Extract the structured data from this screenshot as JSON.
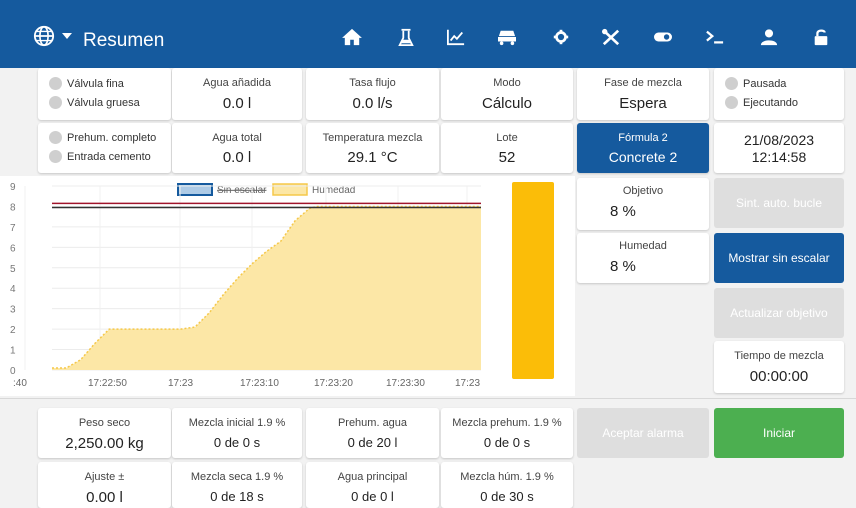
{
  "header": {
    "title": "Resumen",
    "icons": [
      "globe-icon",
      "home-icon",
      "flask-icon",
      "chart-icon",
      "mixer-truck-icon",
      "gear-icon",
      "tools-icon",
      "toggle-icon",
      "terminal-icon",
      "user-icon",
      "unlock-icon"
    ]
  },
  "indicators": {
    "valvula_fina": "Válvula fina",
    "valvula_gruesa": "Válvula gruesa",
    "prehum_completo": "Prehum. completo",
    "entrada_cemento": "Entrada cemento",
    "pausada": "Pausada",
    "ejecutando": "Ejecutando"
  },
  "stats": {
    "agua_anadida": {
      "label": "Agua añadida",
      "value": "0.0 l"
    },
    "tasa_flujo": {
      "label": "Tasa flujo",
      "value": "0.0 l/s"
    },
    "modo": {
      "label": "Modo",
      "value": "Cálculo"
    },
    "fase_mezcla": {
      "label": "Fase de mezcla",
      "value": "Espera"
    },
    "agua_total": {
      "label": "Agua total",
      "value": "0.0 l"
    },
    "temperatura": {
      "label": "Temperatura mezcla",
      "value": "29.1 °C"
    },
    "lote": {
      "label": "Lote",
      "value": "52"
    },
    "formula": {
      "label": "Fórmula 2",
      "value": "Concrete 2"
    },
    "datetime": {
      "date": "21/08/2023",
      "time": "12:14:58"
    },
    "objetivo": {
      "label": "Objetivo",
      "value": "8 %"
    },
    "humedad": {
      "label": "Humedad",
      "value": "8 %"
    },
    "tiempo_mezcla": {
      "label": "Tiempo de mezcla",
      "value": "00:00:00"
    }
  },
  "buttons": {
    "sint_auto_bucle": "Sint. auto. bucle",
    "mostrar_sin_escalar": "Mostrar sin escalar",
    "actualizar_objetivo": "Actualizar objetivo",
    "aceptar_alarma": "Aceptar alarma",
    "iniciar": "Iniciar"
  },
  "bottom": {
    "peso_seco": {
      "label": "Peso seco",
      "value": "2,250.00 kg"
    },
    "mezcla_inicial": {
      "label": "Mezcla inicial 1.9 %",
      "value": "0 de 0 s"
    },
    "prehum_agua": {
      "label": "Prehum. agua",
      "value": "0 de 20 l"
    },
    "mezcla_prehum": {
      "label": "Mezcla prehum. 1.9 %",
      "value": "0 de 0 s"
    },
    "ajuste": {
      "label": "Ajuste ±",
      "value": "0.00 l"
    },
    "mezcla_seca": {
      "label": "Mezcla seca 1.9 %",
      "value": "0 de 18 s"
    },
    "agua_principal": {
      "label": "Agua principal",
      "value": "0 de 0 l"
    },
    "mezcla_hum": {
      "label": "Mezcla húm. 1.9 %",
      "value": "0 de 30 s"
    }
  },
  "colors": {
    "primary": "#155a9e",
    "humedad_fill": "#fce7a6",
    "humedad_line": "#f5c84a",
    "bar": "#fbbd08",
    "target_line_1": "#a0142b",
    "target_line_2": "#333333",
    "green": "#4caf50"
  },
  "chart_data": {
    "type": "area",
    "legend": [
      "Sin escalar",
      "Humedad"
    ],
    "legend_position": "top",
    "x_tick_labels": [
      ":40",
      "17:22:50",
      "17:23",
      "17:23:10",
      "17:23:20",
      "17:23:30",
      "17:23"
    ],
    "y_ticks": [
      0,
      1,
      2,
      3,
      4,
      5,
      6,
      7,
      8,
      9
    ],
    "ylim": [
      0,
      9
    ],
    "xlim": [
      0,
      60
    ],
    "grid": true,
    "series": [
      {
        "name": "Humedad",
        "x": [
          0,
          2,
          4,
          6,
          8,
          10,
          12,
          14,
          16,
          18,
          20,
          22,
          24,
          26,
          28,
          30,
          32,
          34,
          36,
          37,
          38,
          40,
          42,
          44,
          46,
          48,
          50,
          52,
          54,
          56,
          58,
          60
        ],
        "y": [
          0.1,
          0.1,
          0.5,
          1.3,
          2.0,
          2.0,
          2.0,
          2.0,
          2.0,
          2.0,
          2.1,
          2.8,
          3.7,
          4.5,
          5.2,
          5.8,
          6.3,
          7.3,
          7.9,
          8.0,
          8.0,
          8.0,
          8.0,
          8.0,
          8.0,
          8.0,
          8.0,
          8.0,
          8.0,
          8.0,
          8.0,
          8.0
        ]
      },
      {
        "name": "Sin escalar",
        "x": [
          0,
          60
        ],
        "y": [
          8.1,
          8.1
        ]
      }
    ],
    "target_lines": [
      8.15,
      7.95
    ],
    "bar_value": 8
  }
}
